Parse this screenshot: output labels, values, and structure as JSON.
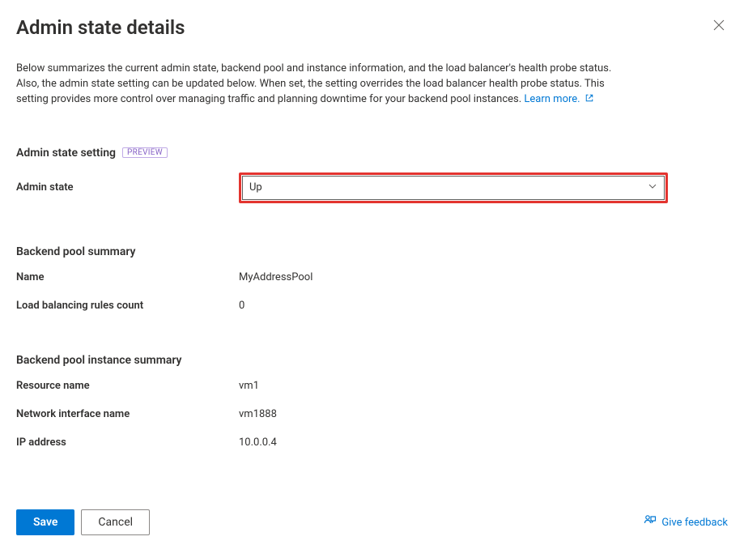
{
  "header": {
    "title": "Admin state details"
  },
  "description": {
    "text": "Below summarizes the current admin state, backend pool and instance information, and the load balancer's health probe status. Also, the admin state setting can be updated below. When set, the setting overrides the load balancer health probe status. This setting provides more control over managing traffic and planning downtime for your backend pool instances.",
    "learn_more_label": "Learn more."
  },
  "admin_state_section": {
    "heading": "Admin state setting",
    "preview_badge": "PREVIEW",
    "admin_state_label": "Admin state",
    "admin_state_value": "Up"
  },
  "backend_pool_summary": {
    "heading": "Backend pool summary",
    "name_label": "Name",
    "name_value": "MyAddressPool",
    "lb_rules_label": "Load balancing rules count",
    "lb_rules_value": "0"
  },
  "backend_pool_instance": {
    "heading": "Backend pool instance summary",
    "resource_name_label": "Resource name",
    "resource_name_value": "vm1",
    "nic_label": "Network interface name",
    "nic_value": "vm1888",
    "ip_label": "IP address",
    "ip_value": "10.0.0.4"
  },
  "footer": {
    "save_label": "Save",
    "cancel_label": "Cancel",
    "feedback_label": "Give feedback"
  }
}
